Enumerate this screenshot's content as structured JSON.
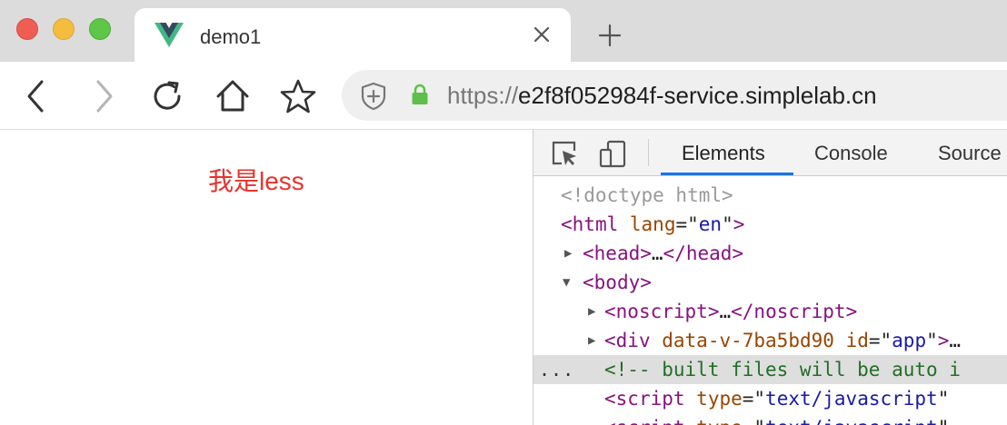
{
  "browser": {
    "tab_title": "demo1",
    "tab_favicon": "vue-logo-icon",
    "url_scheme": "https://",
    "url_host": "e2f8f052984f-service.simplelab.cn"
  },
  "page": {
    "text": "我是less",
    "text_color": "#e8322b"
  },
  "devtools": {
    "tabs": [
      "Elements",
      "Console",
      "Source"
    ],
    "active_tab": "Elements",
    "accent": "#1a73e8",
    "dom": {
      "doctype": "<!doctype html>",
      "html_tag": "html",
      "html_attr": "lang",
      "html_attr_val": "en",
      "head_tag": "head",
      "ellipsis": "…",
      "body_tag": "body",
      "noscript_tag": "noscript",
      "div_tag": "div",
      "div_attr1": "data-v-7ba5bd90",
      "div_attr2": "id",
      "div_attr2_val": "app",
      "selected_dots": "...",
      "comment": "<!-- built files will be auto i",
      "script_tag": "script",
      "script_attr": "type",
      "script_attr_val": "text/javascript"
    }
  }
}
